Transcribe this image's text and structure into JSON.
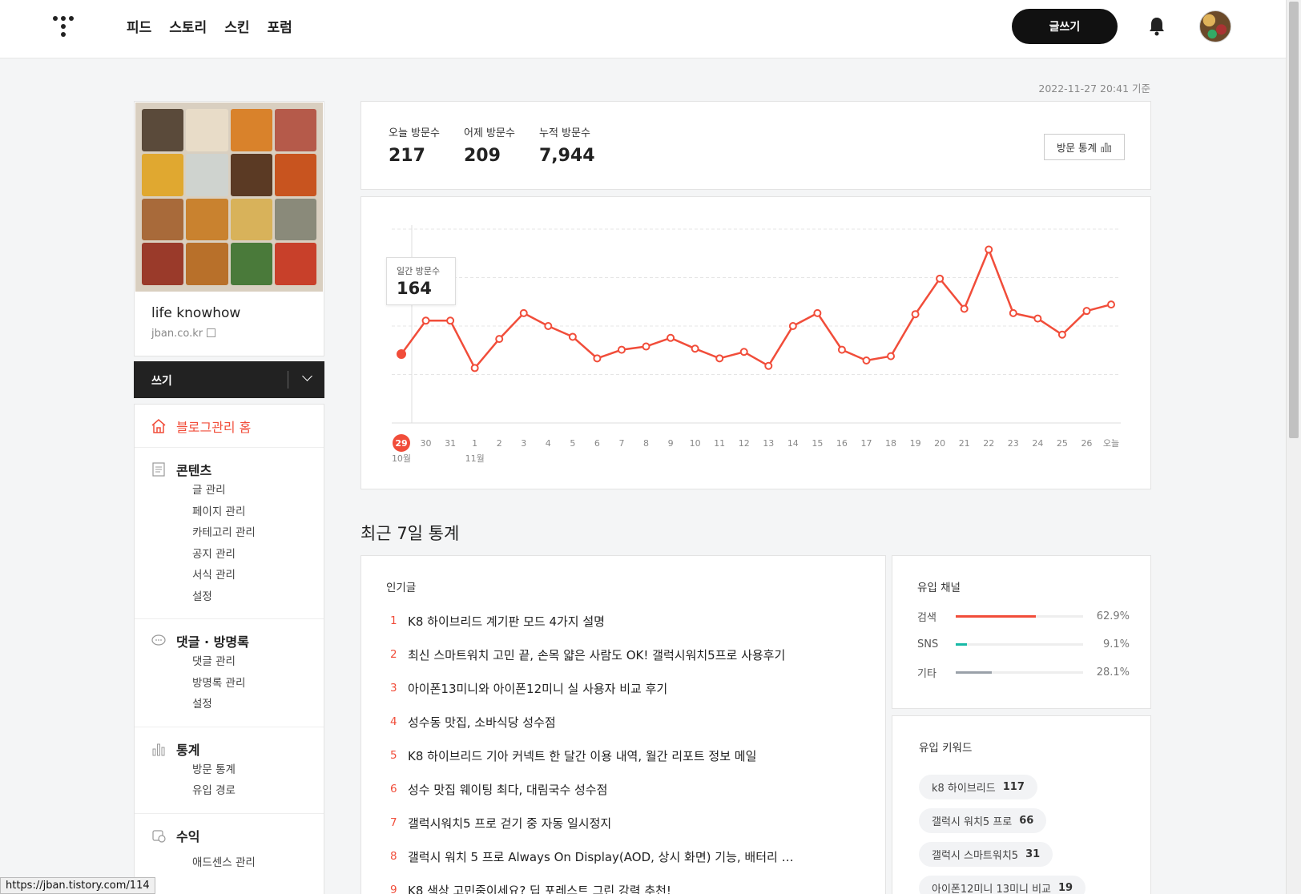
{
  "nav": {
    "links": [
      "피드",
      "스토리",
      "스킨",
      "포럼"
    ],
    "write_label": "글쓰기"
  },
  "timestamp": "2022-11-27 20:41 기준",
  "blog": {
    "name": "life knowhow",
    "url": "jban.co.kr"
  },
  "writebar": {
    "label": "쓰기"
  },
  "menu": {
    "home": "블로그관리 홈",
    "contents": {
      "title": "콘텐츠",
      "items": [
        "글 관리",
        "페이지 관리",
        "카테고리 관리",
        "공지 관리",
        "서식 관리",
        "설정"
      ]
    },
    "comments": {
      "title": "댓글 · 방명록",
      "items": [
        "댓글 관리",
        "방명록 관리",
        "설정"
      ]
    },
    "stats": {
      "title": "통계",
      "items": [
        "방문 통계",
        "유입 경로"
      ]
    },
    "revenue": {
      "title": "수익",
      "items": [
        "애드센스 관리"
      ]
    }
  },
  "visits": {
    "today_label": "오늘 방문수",
    "today": "217",
    "yesterday_label": "어제 방문수",
    "yesterday": "209",
    "total_label": "누적 방문수",
    "total": "7,944",
    "stats_button": "방문 통계"
  },
  "tooltip": {
    "label": "일간 방문수",
    "value": "164"
  },
  "chart_data": {
    "type": "line",
    "x": [
      "29",
      "30",
      "31",
      "1",
      "2",
      "3",
      "4",
      "5",
      "6",
      "7",
      "8",
      "9",
      "10",
      "11",
      "12",
      "13",
      "14",
      "15",
      "16",
      "17",
      "18",
      "19",
      "20",
      "21",
      "22",
      "23",
      "24",
      "25",
      "26",
      "오늘"
    ],
    "month_labels": [
      {
        "index": 0,
        "label": "10월"
      },
      {
        "index": 3,
        "label": "11월"
      }
    ],
    "values": [
      164,
      195,
      195,
      151,
      178,
      202,
      190,
      180,
      160,
      168,
      171,
      179,
      169,
      160,
      166,
      153,
      190,
      202,
      168,
      158,
      162,
      201,
      234,
      206,
      261,
      202,
      197,
      182,
      204,
      210
    ],
    "highlight_index": 0,
    "line_color": "#f14d3a",
    "grid": true
  },
  "recent": {
    "title": "최근 7일 통계",
    "popular_title": "인기글",
    "popular": [
      {
        "rank": "1",
        "title": "K8 하이브리드 계기판 모드 4가지 설명"
      },
      {
        "rank": "2",
        "title": "최신 스마트워치 고민 끝, 손목 얇은 사람도 OK! 갤럭시워치5프로 사용후기"
      },
      {
        "rank": "3",
        "title": "아이폰13미니와 아이폰12미니 실 사용자 비교 후기"
      },
      {
        "rank": "4",
        "title": "성수동 맛집, 소바식당 성수점"
      },
      {
        "rank": "5",
        "title": "K8 하이브리드 기아 커넥트 한 달간 이용 내역, 월간 리포트 정보 메일"
      },
      {
        "rank": "6",
        "title": "성수 맛집 웨이팅 최다, 대림국수 성수점"
      },
      {
        "rank": "7",
        "title": "갤럭시워치5 프로 걷기 중 자동 일시정지"
      },
      {
        "rank": "8",
        "title": "갤럭시 워치 5 프로 Always On Display(AOD, 상시 화면) 기능, 배터리 …"
      },
      {
        "rank": "9",
        "title": "K8 색상 고민중이세요? 딥 포레스트 그린 강력 추천!"
      }
    ],
    "channel_title": "유입 채널",
    "channels": [
      {
        "name": "검색",
        "pct": "62.9%",
        "value": 62.9,
        "color": "#f14d3a"
      },
      {
        "name": "SNS",
        "pct": "9.1%",
        "value": 9.1,
        "color": "#17b9a6"
      },
      {
        "name": "기타",
        "pct": "28.1%",
        "value": 28.1,
        "color": "#9aa1a9"
      }
    ],
    "keyword_title": "유입 키워드",
    "keywords": [
      {
        "kw": "k8 하이브리드",
        "count": "117"
      },
      {
        "kw": "갤럭시 워치5 프로",
        "count": "66"
      },
      {
        "kw": "갤럭시 스마트워치5",
        "count": "31"
      },
      {
        "kw": "아이폰12미니 13미니 비교",
        "count": "19"
      }
    ]
  },
  "statusbar": "https://jban.tistory.com/114"
}
